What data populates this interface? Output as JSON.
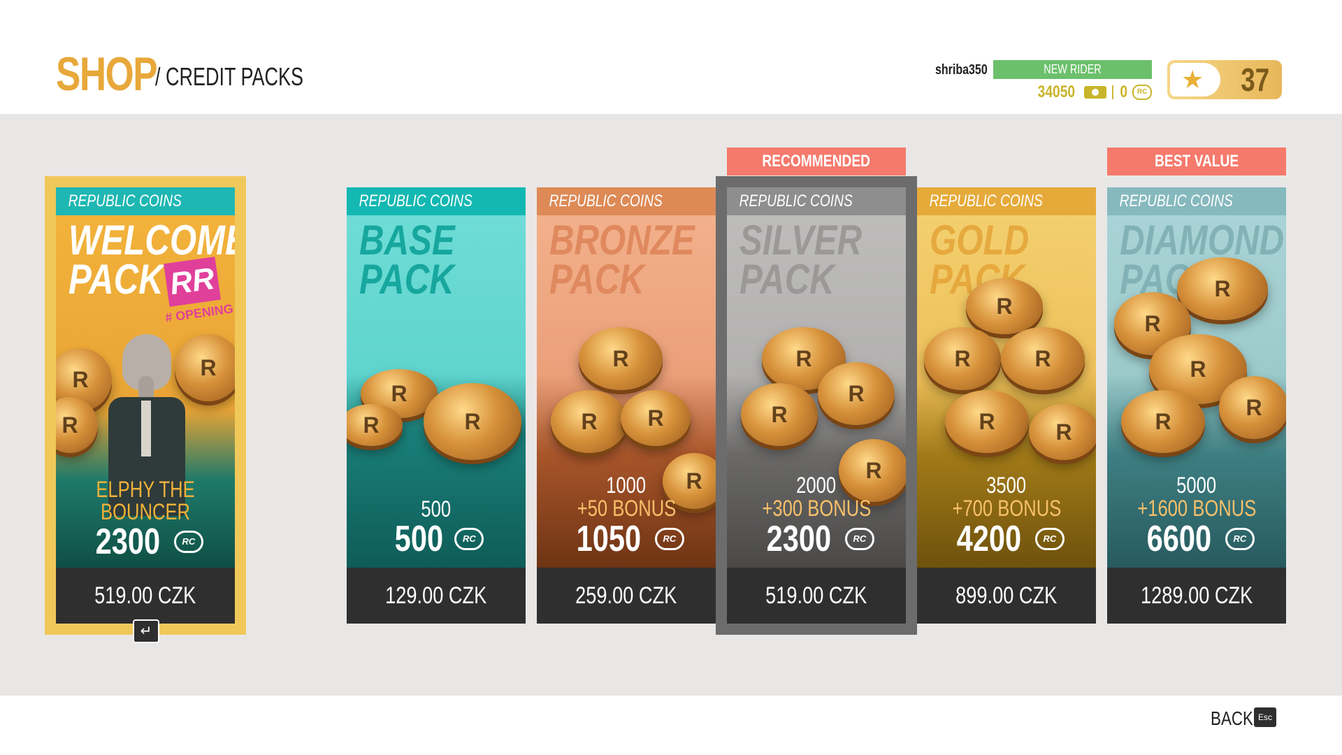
{
  "header": {
    "title": "SHOP",
    "breadcrumb": "/ CREDIT PACKS",
    "username": "shriba350",
    "rank": "NEW RIDER",
    "credits": "34050",
    "rc_balance": "0",
    "level": "37"
  },
  "packs": [
    {
      "type_label": "REPUBLIC COINS",
      "name": "WELCOME\nPACK",
      "subtitle": "ELPHY THE BOUNCER",
      "total": "2300",
      "price": "519.00 CZK",
      "tag": "RR",
      "tag_sub": "# OPENING"
    },
    {
      "type_label": "REPUBLIC COINS",
      "name": "BASE\nPACK",
      "base": "500",
      "total": "500",
      "price": "129.00 CZK"
    },
    {
      "type_label": "REPUBLIC COINS",
      "name": "BRONZE\nPACK",
      "base": "1000",
      "bonus": "+50 BONUS",
      "total": "1050",
      "price": "259.00 CZK"
    },
    {
      "type_label": "REPUBLIC COINS",
      "name": "SILVER\nPACK",
      "base": "2000",
      "bonus": "+300 BONUS",
      "total": "2300",
      "price": "519.00 CZK",
      "banner": "RECOMMENDED"
    },
    {
      "type_label": "REPUBLIC COINS",
      "name": "GOLD\nPACK",
      "base": "3500",
      "bonus": "+700 BONUS",
      "total": "4200",
      "price": "899.00 CZK"
    },
    {
      "type_label": "REPUBLIC COINS",
      "name": "DIAMOND\nPACK",
      "base": "5000",
      "bonus": "+1600 BONUS",
      "total": "6600",
      "price": "1289.00 CZK",
      "banner": "BEST VALUE"
    }
  ],
  "rc_symbol": "RC",
  "enter_symbol": "↵",
  "footer": {
    "back_label": "BACK",
    "back_key": "Esc"
  },
  "colors": {
    "accent_gold": "#e8a83a",
    "rank_green": "#6cc06c",
    "banner_red": "#f57a6c",
    "price_bar": "#2f2f2f",
    "welcome_frame": "#f0c85a",
    "selected_frame": "#6c6c6c"
  }
}
